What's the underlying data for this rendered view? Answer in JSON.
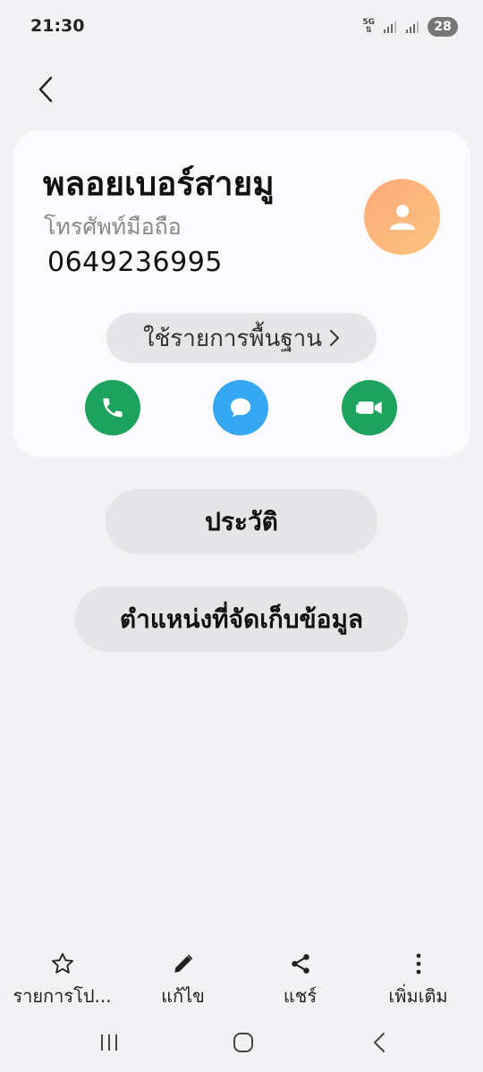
{
  "status_bar": {
    "time": "21:30",
    "network": "5G",
    "battery": "28"
  },
  "contact": {
    "name": "พลอยเบอร์สายมู",
    "phone_type": "โทรศัพท์มือถือ",
    "phone_number": "0649236995",
    "avatar_icon": "person-icon",
    "avatar_color": "#fdb27b",
    "default_chip_label": "ใช้รายการพื้นฐาน",
    "actions": [
      {
        "icon": "phone-icon",
        "color": "#1ea35f"
      },
      {
        "icon": "message-icon",
        "color": "#36a7f2"
      },
      {
        "icon": "video-icon",
        "color": "#1ea35f"
      }
    ]
  },
  "buttons": {
    "history": "ประวัติ",
    "storage_location": "ตำแหน่งที่จัดเก็บข้อมูล"
  },
  "toolbar": {
    "items": [
      {
        "label": "รายการโป...",
        "icon": "star-icon"
      },
      {
        "label": "แก้ไข",
        "icon": "edit-icon"
      },
      {
        "label": "แชร์",
        "icon": "share-icon"
      },
      {
        "label": "เพิ่มเติม",
        "icon": "more-icon"
      }
    ]
  },
  "nav": {
    "icons": [
      "recents-icon",
      "home-icon",
      "back-icon"
    ]
  }
}
